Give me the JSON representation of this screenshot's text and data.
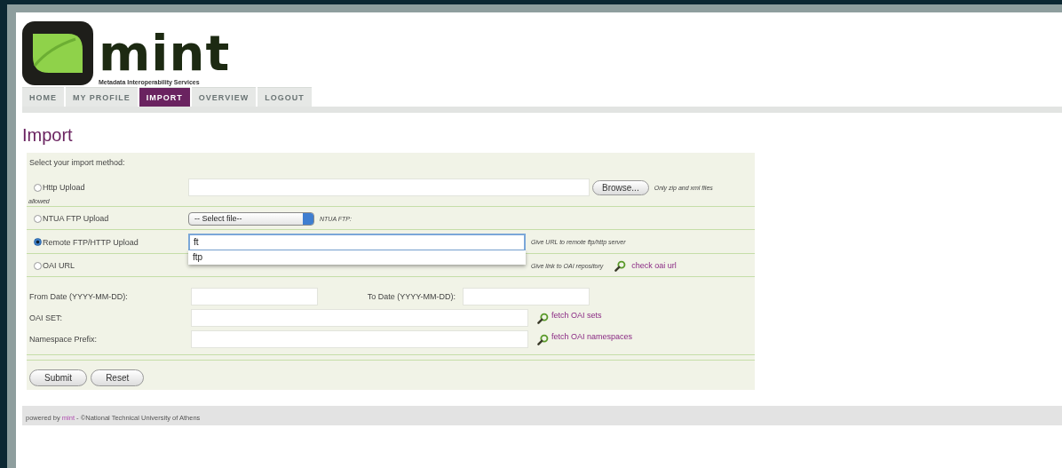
{
  "logo": {
    "name": "mint",
    "tagline": "Metadata Interoperability Services"
  },
  "tabs": [
    {
      "label": "HOME",
      "selected": false
    },
    {
      "label": "MY PROFILE",
      "selected": false
    },
    {
      "label": "IMPORT",
      "selected": true
    },
    {
      "label": "OVERVIEW",
      "selected": false
    },
    {
      "label": "LOGOUT",
      "selected": false
    }
  ],
  "page_title": "Import",
  "intro": "Select your import method:",
  "methods": [
    {
      "kind": "file",
      "label": "Http Upload",
      "selected": false,
      "button": "Browse...",
      "hint": "Only zip and xml files",
      "hint_overflow": "allowed"
    },
    {
      "kind": "select",
      "label": "NTUA FTP Upload",
      "selected": false,
      "value": "-- Select file--",
      "hint": "NTUA FTP:"
    },
    {
      "kind": "text",
      "label": "Remote FTP/HTTP Upload",
      "selected": true,
      "value": "ft",
      "focused": true,
      "suggestions": [
        "ftp"
      ],
      "hint": "Give URL to remote ftp/http server"
    },
    {
      "kind": "oai",
      "label": "OAI URL",
      "selected": false,
      "hint": "Give link to OAI repository",
      "link": "check oai url"
    }
  ],
  "dates": {
    "from_label": "From Date (YYYY-MM-DD):",
    "to_label": "To Date (YYYY-MM-DD):"
  },
  "params": [
    {
      "label": "OAI SET:",
      "link": "fetch OAI sets"
    },
    {
      "label": "Namespace Prefix:",
      "link": "fetch OAI namespaces"
    }
  ],
  "buttons": [
    "Submit",
    "Reset"
  ],
  "footer": {
    "prefix": "powered by",
    "link": "mint",
    "suffix": "- ©National Technical University of Athens"
  }
}
